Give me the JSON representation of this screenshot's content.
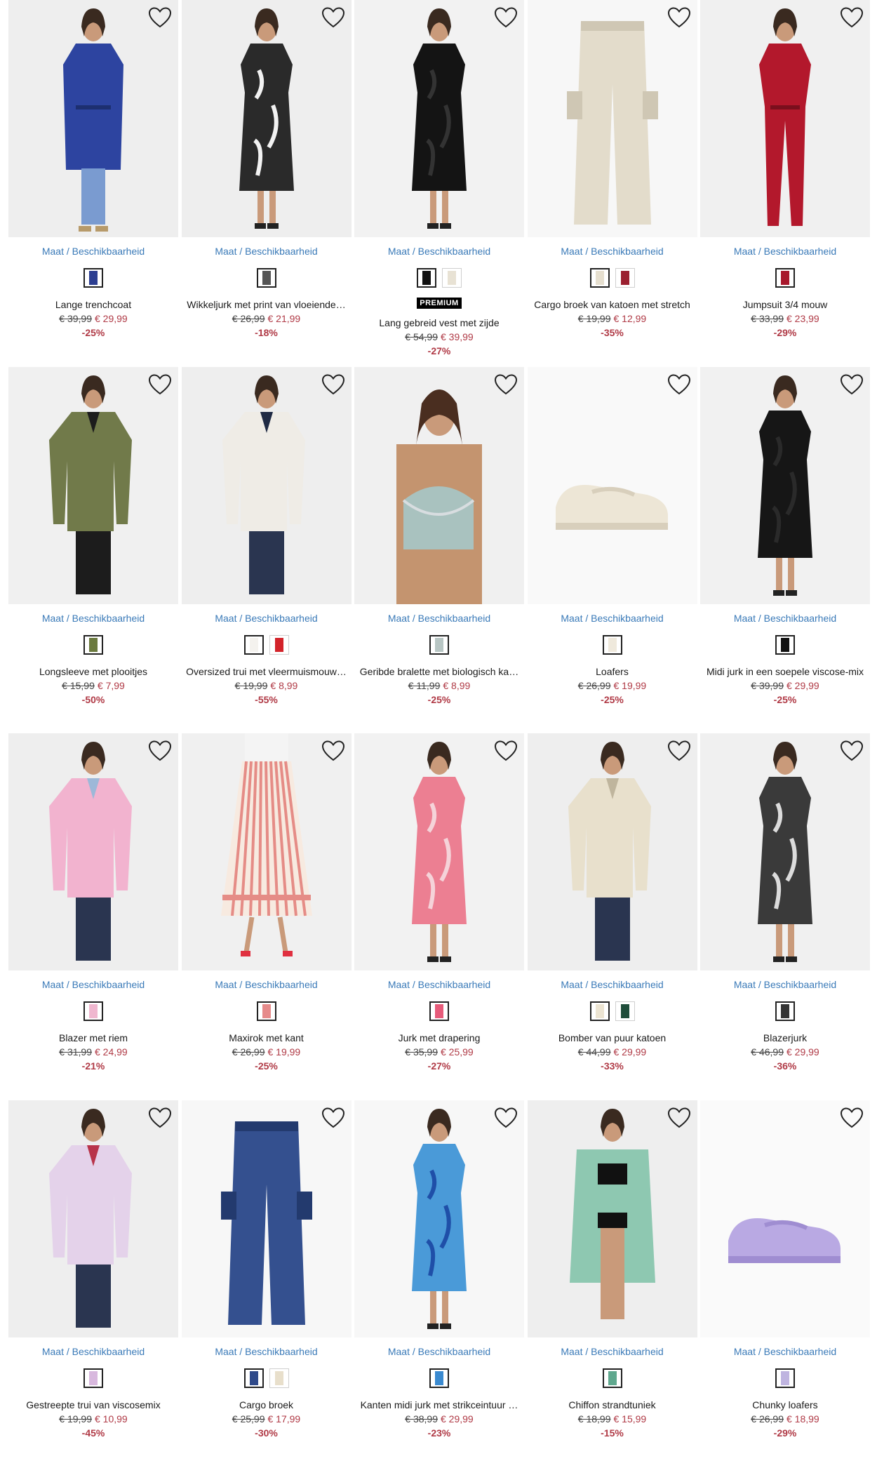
{
  "colors": {
    "link": "#3a7ab8",
    "sale": "#b03a46",
    "badge_bg": "#000000"
  },
  "products": [
    {
      "size_link": "Maat / Beschikbaarheid",
      "name": "Lange trenchcoat",
      "old_price": "€ 39,99",
      "new_price": "€ 29,99",
      "discount": "-25%",
      "swatches": [
        "#2c3e91"
      ],
      "kind": "coat",
      "main": "#2d44a0",
      "accent": "#7a9bd0",
      "bg": "#eeeeee"
    },
    {
      "size_link": "Maat / Beschikbaarheid",
      "name": "Wikkeljurk met print van vloeiende…",
      "old_price": "€ 26,99",
      "new_price": "€ 21,99",
      "discount": "-18%",
      "swatches": [
        "#555555"
      ],
      "kind": "dress",
      "main": "#2a2a2a",
      "accent": "#f2f2f2",
      "bg": "#eeeeee"
    },
    {
      "size_link": "Maat / Beschikbaarheid",
      "name": "Lang gebreid vest met zijde",
      "badge": "PREMIUM",
      "old_price": "€ 54,99",
      "new_price": "€ 39,99",
      "discount": "-27%",
      "swatches": [
        "#111111",
        "#e8e2d4"
      ],
      "kind": "dress",
      "main": "#141414",
      "accent": "#333333",
      "bg": "#f2f2f2"
    },
    {
      "size_link": "Maat / Beschikbaarheid",
      "name": "Cargo broek van katoen met stretch",
      "old_price": "€ 19,99",
      "new_price": "€ 12,99",
      "discount": "-35%",
      "swatches": [
        "#e6dfcf",
        "#9b1f2f"
      ],
      "kind": "pants",
      "main": "#e3dccb",
      "accent": "#cfc7b4",
      "bg": "#f7f7f7"
    },
    {
      "size_link": "Maat / Beschikbaarheid",
      "name": "Jumpsuit 3/4 mouw",
      "old_price": "€ 33,99",
      "new_price": "€ 23,99",
      "discount": "-29%",
      "swatches": [
        "#a8182c"
      ],
      "kind": "jumpsuit",
      "main": "#b3182c",
      "accent": "#7a0f1d",
      "bg": "#f0f0f0"
    },
    {
      "size_link": "Maat / Beschikbaarheid",
      "name": "Longsleeve met plooitjes",
      "old_price": "€ 15,99",
      "new_price": "€ 7,99",
      "discount": "-50%",
      "swatches": [
        "#6b7a3e"
      ],
      "kind": "top",
      "main": "#717a4a",
      "accent": "#1c1c1c",
      "bg": "#f0f0f0"
    },
    {
      "size_link": "Maat / Beschikbaarheid",
      "name": "Oversized trui met vleermuismouw…",
      "old_price": "€ 19,99",
      "new_price": "€ 8,99",
      "discount": "-55%",
      "swatches": [
        "#f4f2ee",
        "#d3232a"
      ],
      "kind": "top",
      "main": "#efece6",
      "accent": "#1f2a44",
      "bg": "#eeeeee"
    },
    {
      "size_link": "Maat / Beschikbaarheid",
      "name": "Geribde bralette met biologisch ka…",
      "old_price": "€ 11,99",
      "new_price": "€ 8,99",
      "discount": "-25%",
      "swatches": [
        "#b8c6c4"
      ],
      "kind": "bra",
      "main": "#a9c2bf",
      "accent": "#c4946f",
      "bg": "#f0f0f0"
    },
    {
      "size_link": "Maat / Beschikbaarheid",
      "name": "Loafers",
      "old_price": "€ 26,99",
      "new_price": "€ 19,99",
      "discount": "-25%",
      "swatches": [
        "#efe9dc"
      ],
      "kind": "shoe",
      "main": "#ede6d6",
      "accent": "#d8cfbc",
      "bg": "#f9f9f9"
    },
    {
      "size_link": "Maat / Beschikbaarheid",
      "name": "Midi jurk in een soepele viscose-mix",
      "old_price": "€ 39,99",
      "new_price": "€ 29,99",
      "discount": "-25%",
      "swatches": [
        "#111111"
      ],
      "kind": "dress",
      "main": "#161616",
      "accent": "#2a2a2a",
      "bg": "#f1f1f1"
    },
    {
      "size_link": "Maat / Beschikbaarheid",
      "name": "Blazer met riem",
      "old_price": "€ 31,99",
      "new_price": "€ 24,99",
      "discount": "-21%",
      "swatches": [
        "#f0b7cf"
      ],
      "kind": "top",
      "main": "#f2b3cf",
      "accent": "#9db8d8",
      "bg": "#eeeeee"
    },
    {
      "size_link": "Maat / Beschikbaarheid",
      "name": "Maxirok met kant",
      "old_price": "€ 26,99",
      "new_price": "€ 19,99",
      "discount": "-25%",
      "swatches": [
        "#e68a8a"
      ],
      "kind": "skirt",
      "main": "#e58c86",
      "accent": "#f7eae0",
      "bg": "#f0f0f0"
    },
    {
      "size_link": "Maat / Beschikbaarheid",
      "name": "Jurk met drapering",
      "old_price": "€ 35,99",
      "new_price": "€ 25,99",
      "discount": "-27%",
      "swatches": [
        "#e75b7a"
      ],
      "kind": "dress",
      "main": "#ec7f92",
      "accent": "#f5d3d9",
      "bg": "#f2f2f2"
    },
    {
      "size_link": "Maat / Beschikbaarheid",
      "name": "Bomber van puur katoen",
      "old_price": "€ 44,99",
      "new_price": "€ 29,99",
      "discount": "-33%",
      "swatches": [
        "#ece4d2",
        "#1f4d3a"
      ],
      "kind": "top",
      "main": "#e8e0cc",
      "accent": "#bfb59d",
      "bg": "#eeeeee"
    },
    {
      "size_link": "Maat / Beschikbaarheid",
      "name": "Blazerjurk",
      "old_price": "€ 46,99",
      "new_price": "€ 29,99",
      "discount": "-36%",
      "swatches": [
        "#333333"
      ],
      "kind": "dress",
      "main": "#3a3a3a",
      "accent": "#dcdcdc",
      "bg": "#f0f0f0"
    },
    {
      "size_link": "Maat / Beschikbaarheid",
      "name": "Gestreepte trui van viscosemix",
      "old_price": "€ 19,99",
      "new_price": "€ 10,99",
      "discount": "-45%",
      "swatches": [
        "#d8b8de"
      ],
      "kind": "top",
      "main": "#e4d2ea",
      "accent": "#b8344a",
      "bg": "#eeeeee"
    },
    {
      "size_link": "Maat / Beschikbaarheid",
      "name": "Cargo broek",
      "old_price": "€ 25,99",
      "new_price": "€ 17,99",
      "discount": "-30%",
      "swatches": [
        "#2f4a8a",
        "#e8dfcb"
      ],
      "kind": "pants",
      "main": "#34508f",
      "accent": "#233a6e",
      "bg": "#f7f7f7"
    },
    {
      "size_link": "Maat / Beschikbaarheid",
      "name": "Kanten midi jurk met strikceintuur …",
      "old_price": "€ 38,99",
      "new_price": "€ 29,99",
      "discount": "-23%",
      "swatches": [
        "#3a8ad0"
      ],
      "kind": "dress",
      "main": "#4a9ad8",
      "accent": "#1f4fa8",
      "bg": "#f7f7f7"
    },
    {
      "size_link": "Maat / Beschikbaarheid",
      "name": "Chiffon strandtuniek",
      "old_price": "€ 18,99",
      "new_price": "€ 15,99",
      "discount": "-15%",
      "swatches": [
        "#5fa88e"
      ],
      "kind": "tunic",
      "main": "#7cc1a6",
      "accent": "#111111",
      "bg": "#eeeeee"
    },
    {
      "size_link": "Maat / Beschikbaarheid",
      "name": "Chunky loafers",
      "old_price": "€ 26,99",
      "new_price": "€ 18,99",
      "discount": "-29%",
      "swatches": [
        "#bfb4e0"
      ],
      "kind": "shoe",
      "main": "#b9a9e3",
      "accent": "#9f8dd1",
      "bg": "#fafafa"
    }
  ]
}
